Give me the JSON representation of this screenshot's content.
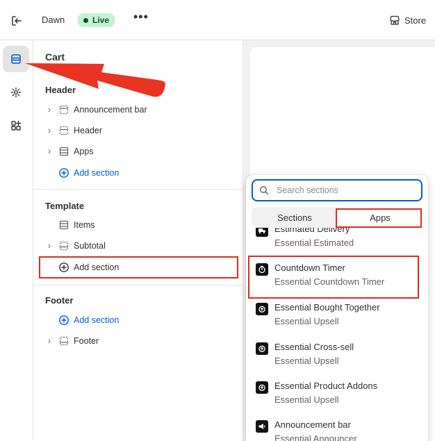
{
  "topbar": {
    "theme_name": "Dawn",
    "status_badge": "Live",
    "more_label": "•••",
    "store_label": "Store"
  },
  "rail": {
    "items": [
      "sections-icon",
      "settings-icon",
      "apps-icon"
    ]
  },
  "panel": {
    "title": "Cart",
    "header_group": {
      "heading": "Header",
      "items": [
        "Announcement bar",
        "Header",
        "Apps"
      ],
      "add_label": "Add section"
    },
    "template_group": {
      "heading": "Template",
      "items": [
        "Items",
        "Subtotal"
      ],
      "add_label": "Add section"
    },
    "footer_group": {
      "heading": "Footer",
      "add_label": "Add section",
      "items": [
        "Footer"
      ]
    }
  },
  "popover": {
    "search_placeholder": "Search sections",
    "tabs": [
      "Sections",
      "Apps"
    ],
    "active_tab": "Apps",
    "apps": [
      {
        "name": "Estimated Delivery",
        "provider": "Essential Estimated"
      },
      {
        "name": "Countdown Timer",
        "provider": "Essential Countdown Timer"
      },
      {
        "name": "Essential Bought Together",
        "provider": "Essential Upsell"
      },
      {
        "name": "Essential Cross-sell",
        "provider": "Essential Upsell"
      },
      {
        "name": "Essential Product Addons",
        "provider": "Essential Upsell"
      },
      {
        "name": "Announcement bar",
        "provider": "Essential Announcer"
      }
    ]
  },
  "colors": {
    "accent_blue": "#005bd3",
    "live_badge_bg": "#c5f2cf",
    "annotation_red": "#e02a1b"
  }
}
